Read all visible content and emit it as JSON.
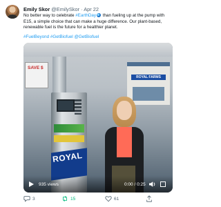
{
  "tweet": {
    "author_name": "Emily Skor",
    "author_handle": "@EmilySkor",
    "date": "Apr 22",
    "text_part1": "No better way to celebrate ",
    "text_hashtag1": "#EarthDay",
    "text_part2": " than fueling up at the pump with E15, a simple choice that can make a huge difference. Our plant-based, renewable fuel is the future for a healthier planet.",
    "hashtags": "#FuelBeyond #GetBiofuel @GetBiofuel"
  },
  "video": {
    "views": "935 views",
    "time": "0:00 / 0:25",
    "pump_sign_text": "SAVE $",
    "building_sign_text": "ROYAL FARMS",
    "pump_brand_text": "ROYAL"
  },
  "actions": {
    "reply_count": "3",
    "retweet_count": "15",
    "like_count": "61"
  },
  "colors": {
    "link": "#1d9bf0",
    "retweet": "#00ba7c",
    "muted": "#536471"
  },
  "icons": {
    "reply": "reply-icon",
    "retweet": "retweet-icon",
    "like": "heart-icon",
    "share": "share-icon",
    "play": "play-icon",
    "volume": "volume-icon",
    "fullscreen": "fullscreen-icon",
    "globe": "globe-emoji-icon"
  }
}
